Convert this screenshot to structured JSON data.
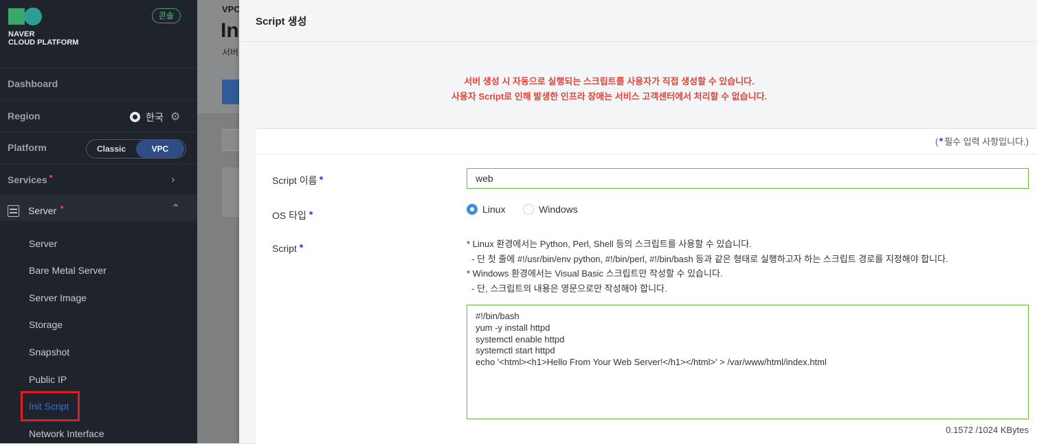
{
  "sidebar": {
    "logo": {
      "line1": "NAVER",
      "line2": "CLOUD PLATFORM"
    },
    "console_badge": "콘솔",
    "dashboard_label": "Dashboard",
    "region": {
      "label": "Region",
      "value": "한국"
    },
    "platform": {
      "label": "Platform",
      "options": [
        "Classic",
        "VPC"
      ],
      "selected": "VPC"
    },
    "services_label": "Services",
    "server_label": "Server",
    "submenu": [
      "Server",
      "Bare Metal Server",
      "Server Image",
      "Storage",
      "Snapshot",
      "Public IP",
      "Init Script",
      "Network Interface"
    ],
    "active_item": "Init Script"
  },
  "background_page": {
    "breadcrumb": "VPC",
    "title": "In",
    "subtitle": "서버"
  },
  "modal": {
    "title": "Script 생성",
    "notice_line1": "서버 생성 시 자동으로 실행되는 스크립트를 사용자가 직접 생성할 수 있습니다.",
    "notice_line2": "사용자 Script로 인해 발생한 인프라 장애는 서비스 고객센터에서 처리할 수 없습니다.",
    "required_note_prefix": "(",
    "required_note_text": "필수 입력 사항입니다.)",
    "fields": {
      "name_label": "Script 이름",
      "name_value": "web",
      "os_label": "OS 타입",
      "os_options": [
        "Linux",
        "Windows"
      ],
      "os_selected": "Linux",
      "script_label": "Script"
    },
    "script_desc": [
      "* Linux 환경에서는 Python, Perl, Shell 등의 스크립트를 사용할 수 있습니다.",
      "  - 단 첫 줄에 #!/usr/bin/env python, #!/bin/perl, #!/bin/bash 등과 같은 형태로 실행하고자 하는 스크립트 경로를 지정해야 합니다.",
      "* Windows 환경에서는 Visual Basic 스크립트만 작성할 수 있습니다.",
      "  - 단, 스크립트의 내용은 영문으로만 작성해야 합니다."
    ],
    "script_content": "#!/bin/bash\nyum -y install httpd\nsystemctl enable httpd\nsystemctl start httpd\necho '<html><h1>Hello From Your Web Server!</h1></html>' > /var/www/html/index.html",
    "size_note": "0.1572 /1024 KBytes"
  },
  "colors": {
    "accent": "#3f6fd6",
    "warning": "#e0453a",
    "input_border": "#69b33f",
    "highlight": "#e0201f"
  }
}
